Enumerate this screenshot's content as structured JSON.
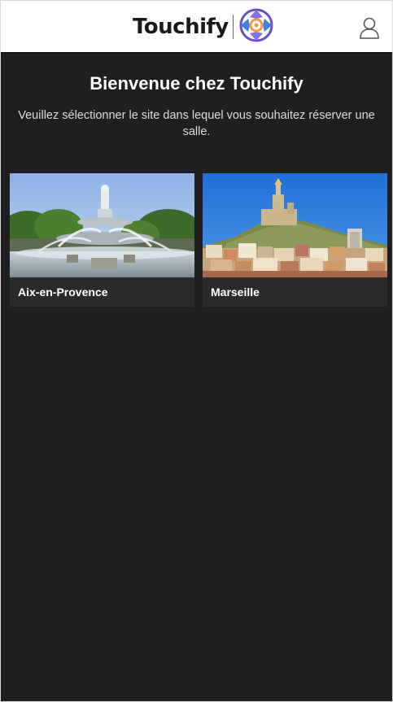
{
  "header": {
    "brand_name": "Touchify",
    "icons": {
      "logo": "touchify-logo-icon",
      "user": "user-icon"
    },
    "colors": {
      "logo_purple": "#6a4fc4",
      "logo_blue": "#3f7fe0",
      "logo_orange": "#f19a3e"
    }
  },
  "main": {
    "title": "Bienvenue chez Touchify",
    "subtitle": "Veuillez sélectionner le site dans lequel vous souhaitez réserver une salle."
  },
  "sites": [
    {
      "label": "Aix-en-Provence"
    },
    {
      "label": "Marseille"
    }
  ],
  "theme": {
    "background": "#1f1f21",
    "card_background": "#2a2a2d",
    "header_background": "#ffffff"
  }
}
